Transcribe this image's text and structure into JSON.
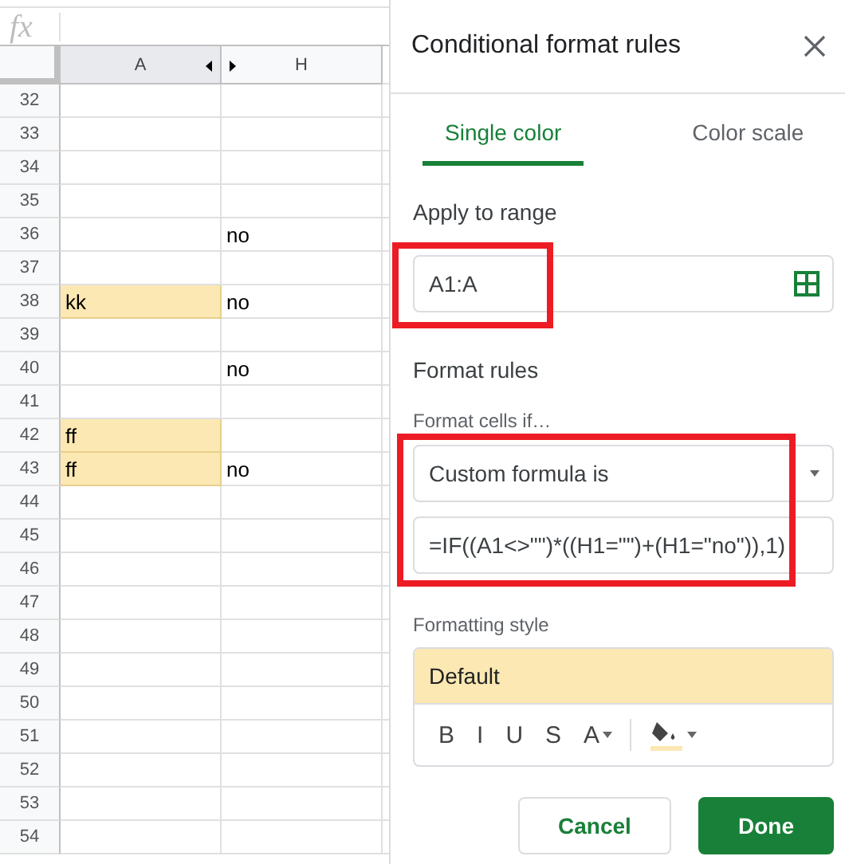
{
  "formula_bar": {
    "label": "fx"
  },
  "columns": [
    {
      "label": "A",
      "kind": "before_hidden"
    },
    {
      "label": "H",
      "kind": "after_hidden"
    }
  ],
  "rows": [
    {
      "number": "32",
      "a_highlighted": false
    },
    {
      "number": "33",
      "a_highlighted": false
    },
    {
      "number": "34",
      "a_highlighted": false
    },
    {
      "number": "35",
      "a_highlighted": false
    },
    {
      "number": "36",
      "a_highlighted": false,
      "h": "no"
    },
    {
      "number": "37",
      "a_highlighted": false
    },
    {
      "number": "38",
      "a": "kk",
      "a_highlighted": true,
      "h": "no"
    },
    {
      "number": "39",
      "a_highlighted": false
    },
    {
      "number": "40",
      "a_highlighted": false,
      "h": "no"
    },
    {
      "number": "41",
      "a_highlighted": false
    },
    {
      "number": "42",
      "a": "ff",
      "a_highlighted": true
    },
    {
      "number": "43",
      "a": "ff",
      "a_highlighted": true,
      "h": "no"
    },
    {
      "number": "44",
      "a_highlighted": false
    },
    {
      "number": "45",
      "a_highlighted": false
    },
    {
      "number": "46",
      "a_highlighted": false
    },
    {
      "number": "47",
      "a_highlighted": false
    },
    {
      "number": "48",
      "a_highlighted": false
    },
    {
      "number": "49",
      "a_highlighted": false
    },
    {
      "number": "50",
      "a_highlighted": false
    },
    {
      "number": "51",
      "a_highlighted": false
    },
    {
      "number": "52",
      "a_highlighted": false
    },
    {
      "number": "53",
      "a_highlighted": false
    },
    {
      "number": "54",
      "a_highlighted": false
    }
  ],
  "panel": {
    "title": "Conditional format rules",
    "tabs": [
      {
        "label": "Single color",
        "selected": true
      },
      {
        "label": "Color scale",
        "selected": false
      }
    ],
    "apply_to_range": {
      "label": "Apply to range",
      "value": "A1:A"
    },
    "format_rules": {
      "label": "Format rules",
      "condition_label": "Format cells if…",
      "condition": "Custom formula is",
      "formula": "=IF((A1<>\"\")*((H1=\"\")+(H1=\"no\")),1)"
    },
    "formatting_style": {
      "label": "Formatting style",
      "preset": "Default",
      "tools": [
        {
          "kind": "bold",
          "label": "B"
        },
        {
          "kind": "italic",
          "label": "I"
        },
        {
          "kind": "underline",
          "label": "U"
        },
        {
          "kind": "strike",
          "label": "S"
        },
        {
          "kind": "text_color",
          "label": "A"
        },
        {
          "kind": "fill"
        }
      ]
    },
    "buttons": [
      {
        "label": "Cancel",
        "kind": "secondary"
      },
      {
        "label": "Done",
        "kind": "primary"
      }
    ]
  }
}
